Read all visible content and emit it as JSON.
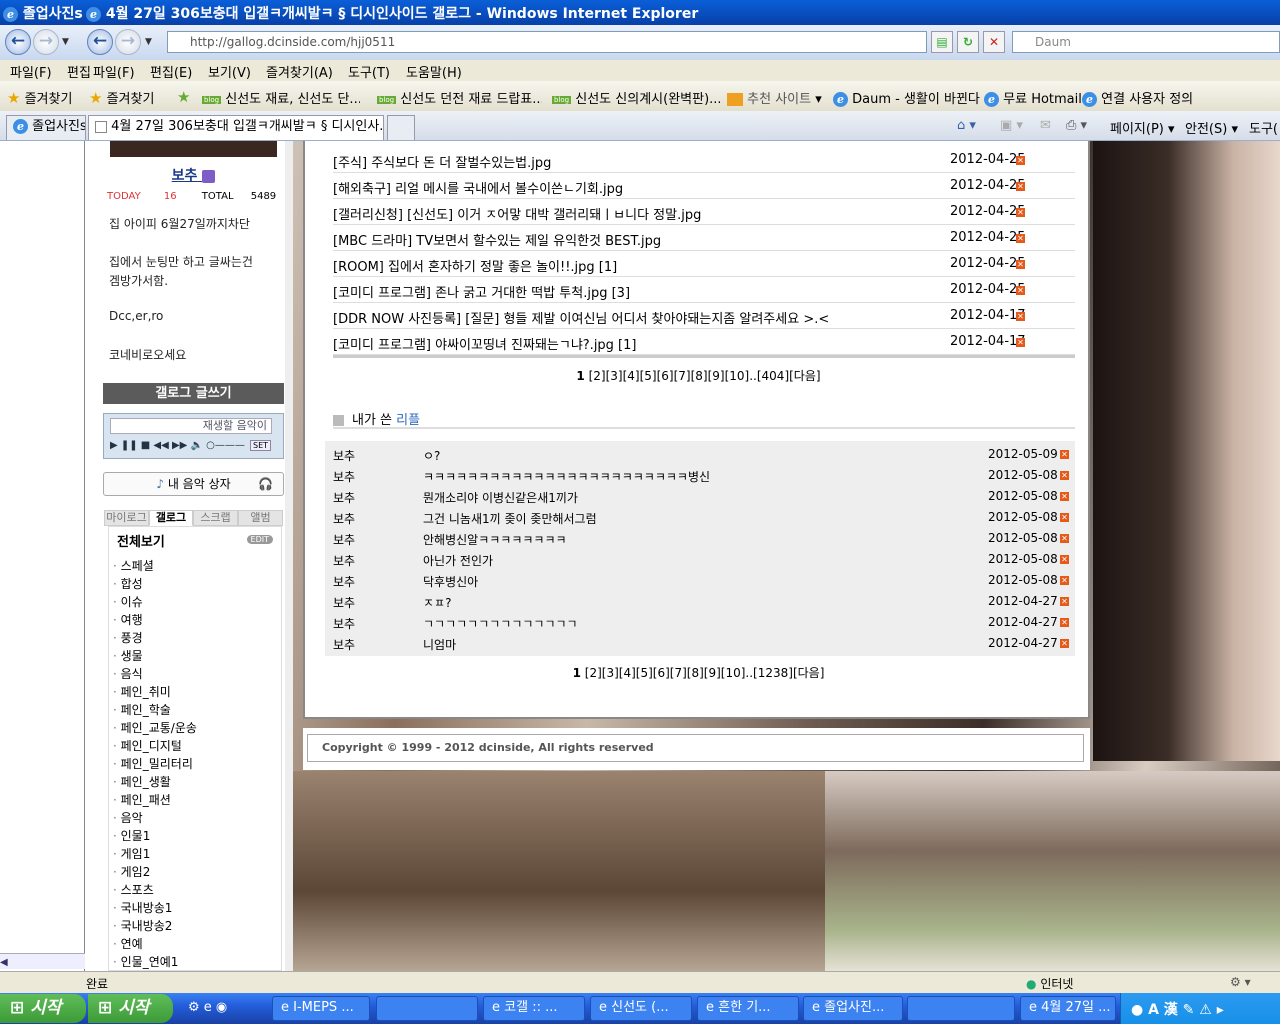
{
  "window": {
    "title_tab1": "졸업사진s",
    "title": "4월 27일 306보충대 입갤ㅋ개씨발ㅋ § 디시인사이드 갤로그 - Windows Internet Explorer"
  },
  "nav": {
    "address": "http://gallog.dcinside.com/hjj0511",
    "search_placeholder": "Daum"
  },
  "menus": [
    "파일(F)",
    "편집",
    "파일(F)",
    "편집(E)",
    "보기(V)",
    "즐겨찾기(A)",
    "도구(T)",
    "도움말(H)"
  ],
  "favorites": {
    "fav1": "즐겨찾기",
    "fav2": "즐겨찾기",
    "links": [
      "신선도 재료, 신선도 단...",
      "신선도 던전 재료 드랍표...",
      "신선도 신의계시(완벽판)...",
      "추천 사이트",
      "Daum - 생활이 바뀐다",
      "무료 Hotmail",
      "연결 사용자 정의"
    ]
  },
  "tabs": {
    "tab1": "졸업사진s",
    "tab2": "4월 27일 306보충대 입갤ㅋ개씨발ㅋ § 디시인사...",
    "tools": [
      "페이지(P)",
      "안전(S)",
      "도구("
    ]
  },
  "sidebar": {
    "nick": "보추",
    "today_label": "TODAY",
    "today_value": "16",
    "total_label": "TOTAL",
    "total_value": "5489",
    "msg1": "집 아이피 6월27일까지차단",
    "msg2a": "집에서 눈팅만 하고 글싸는건",
    "msg2b": "겜방가서함.",
    "msg3": "Dcc,er,ro",
    "msg4": "코네비로오세요",
    "write_button": "갤로그 글쓰기",
    "player_text": "재생할 음악이",
    "player_set": "SET",
    "music_box": "내 음악 상자",
    "tabs": [
      "마이로그",
      "갤로그",
      "스크랩",
      "앨범"
    ],
    "cat_head": "전체보기",
    "edit": "EDIT",
    "categories": [
      "스페셜",
      "합성",
      "이슈",
      "여행",
      "풍경",
      "생물",
      "음식",
      "페인_취미",
      "페인_학술",
      "페인_교통/운송",
      "페인_디지털",
      "페인_밀리터리",
      "페인_생활",
      "페인_패션",
      "음악",
      "인물1",
      "게임1",
      "게임2",
      "스포츠",
      "국내방송1",
      "국내방송2",
      "연예",
      "인물_연예1"
    ]
  },
  "posts": [
    {
      "title": "[주식] 주식보다 돈 더 잘벌수있는법.jpg",
      "date": "2012-04-25"
    },
    {
      "title": "[해외축구] 리얼 메시를 국내에서 볼수이쓴ㄴ기회.jpg",
      "date": "2012-04-25"
    },
    {
      "title": "[갤러리신청] [신선도] 이거 ㅈ어맣 대박 갤러리돼ㅣㅂ니다 정말.jpg",
      "date": "2012-04-25"
    },
    {
      "title": "[MBC 드라마] TV보면서 할수있는 제일 유익한것 BEST.jpg",
      "date": "2012-04-25"
    },
    {
      "title": "[ROOM] 집에서 혼자하기 정말 좋은 놀이!!.jpg [1]",
      "date": "2012-04-25"
    },
    {
      "title": "[코미디 프로그램] 존나 굵고 거대한 떡밥 투척.jpg [3]",
      "date": "2012-04-25"
    },
    {
      "title": "[DDR NOW 사진등록] [질문] 형들 제발 이여신님 어디서 찾아야돼는지좀 알려주세요 >.<",
      "date": "2012-04-17"
    },
    {
      "title": "[코미디 프로그램] 야싸이꼬띵녀 진짜돼는ㄱ냐?.jpg [1]",
      "date": "2012-04-17"
    }
  ],
  "posts_pager": {
    "current": "1",
    "rest": "[2][3][4][5][6][7][8][9][10]..[404][다음]"
  },
  "replies_heading": {
    "prefix": "내가 쓴",
    "highlight": "리플"
  },
  "replies": [
    {
      "author": "보추",
      "comment": "ㅇ?",
      "date": "2012-05-09"
    },
    {
      "author": "보추",
      "comment": "ㅋㅋㅋㅋㅋㅋㅋㅋㅋㅋㅋㅋㅋㅋㅋㅋㅋㅋㅋㅋㅋㅋㅋㅋ병신",
      "date": "2012-05-08"
    },
    {
      "author": "보추",
      "comment": "뭔개소리야 이병신같은새1끼가",
      "date": "2012-05-08"
    },
    {
      "author": "보추",
      "comment": "그건 니놈새1끼 좆이 좆만해서그럼",
      "date": "2012-05-08"
    },
    {
      "author": "보추",
      "comment": "안해병신알ㅋㅋㅋㅋㅋㅋㅋㅋ",
      "date": "2012-05-08"
    },
    {
      "author": "보추",
      "comment": "아닌가 전인가",
      "date": "2012-05-08"
    },
    {
      "author": "보추",
      "comment": "닥후병신아",
      "date": "2012-05-08"
    },
    {
      "author": "보추",
      "comment": "ㅈㅍ?",
      "date": "2012-04-27"
    },
    {
      "author": "보추",
      "comment": "ㄱㄱㄱㄱㄱㄱㄱㄱㄱㄱㄱㄱㄱㄱ",
      "date": "2012-04-27"
    },
    {
      "author": "보추",
      "comment": "니엄마",
      "date": "2012-04-27"
    }
  ],
  "replies_pager": {
    "current": "1",
    "rest": "[2][3][4][5][6][7][8][9][10]..[1238][다음]"
  },
  "copyright": "Copyright © 1999 - 2012 dcinside, All rights reserved",
  "status": {
    "done": "완료",
    "zone": "인터넷"
  },
  "taskbar": {
    "start1": "시작",
    "start2": "시작",
    "tasks": [
      "I-MEPS ...",
      "",
      "코갤 :: ...",
      "신선도 (...",
      "흔한 기...",
      "졸업사진...",
      "",
      "4월 27일 ..."
    ]
  }
}
